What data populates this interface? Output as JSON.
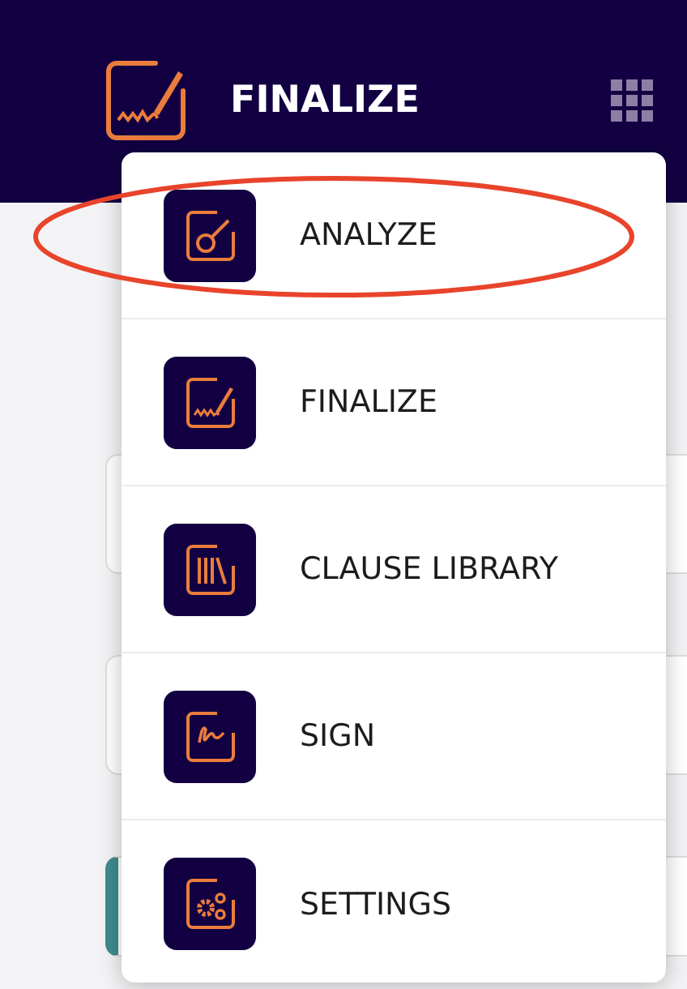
{
  "header": {
    "title": "FINALIZE"
  },
  "menu": {
    "items": [
      {
        "kind": "analyze",
        "label": "ANALYZE",
        "highlighted": true
      },
      {
        "kind": "finalize",
        "label": "FINALIZE",
        "highlighted": false
      },
      {
        "kind": "library",
        "label": "CLAUSE LIBRARY",
        "highlighted": false
      },
      {
        "kind": "sign",
        "label": "SIGN",
        "highlighted": false
      },
      {
        "kind": "settings",
        "label": "SETTINGS",
        "highlighted": false
      }
    ]
  }
}
